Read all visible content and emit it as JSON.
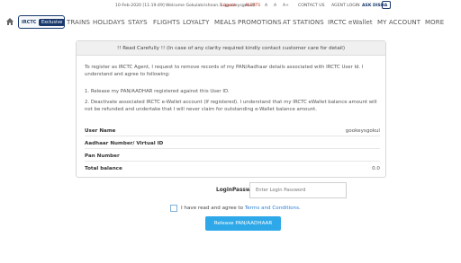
{
  "topbar": {
    "datetime": "10-Feb-2020 [11:19:49]",
    "welcome": "Welcome Gokulakrishnan.S (gookeysgokul)",
    "logout": "Logout",
    "alerts": "ALERTS",
    "font_a1": "A",
    "font_a2": "A",
    "font_a3": "A+",
    "contact": "CONTACT US",
    "agent_login": "AGENT LOGIN",
    "ask_disha": "ASK DISHA"
  },
  "brand": {
    "name": "IRCTC",
    "badge": "Exclusive"
  },
  "nav": {
    "items": [
      "TRAINS",
      "HOLIDAYS",
      "STAYS",
      "FLIGHTS",
      "LOYALTY",
      "MEALS",
      "PROMOTIONS",
      "AT STATIONS",
      "IRCTC eWallet",
      "MY ACCOUNT",
      "MORE"
    ]
  },
  "panel": {
    "heading": "!! Read Carefully !! (In case of any clarity required kindly contact customer care for detail)",
    "intro": "To register as IRCTC Agent, I request to remove records of my PAN/Aadhaar details associated with IRCTC User Id. I understand and agree to following:",
    "point1": "1. Release my PAN/AADHAR registered against this User ID.",
    "point2": "2. Deactivate associated IRCTC e-Wallet account (If registered). I understand that my IRCTC eWallet balance amount will not be refunded and undertake that I will never claim for outstanding e-Wallet balance amount.",
    "rows": [
      {
        "label": "User Name",
        "value": "gookeysgokul"
      },
      {
        "label": "Aadhaar Number/ Virtual ID",
        "value": ""
      },
      {
        "label": "Pan Number",
        "value": ""
      },
      {
        "label": "Total balance",
        "value": "0.0"
      }
    ]
  },
  "login": {
    "label": "LoginPassword:",
    "placeholder": "Enter Login Password"
  },
  "terms": {
    "prefix": "I have read and agree to",
    "link": "Terms and Conditions."
  },
  "release_button": "Release PAN/AADHAAR",
  "colors": {
    "brand_blue": "#1a3a6e",
    "button_blue": "#2ea8e8",
    "link_blue": "#2a7fd4",
    "alert_red": "#c0392b"
  }
}
